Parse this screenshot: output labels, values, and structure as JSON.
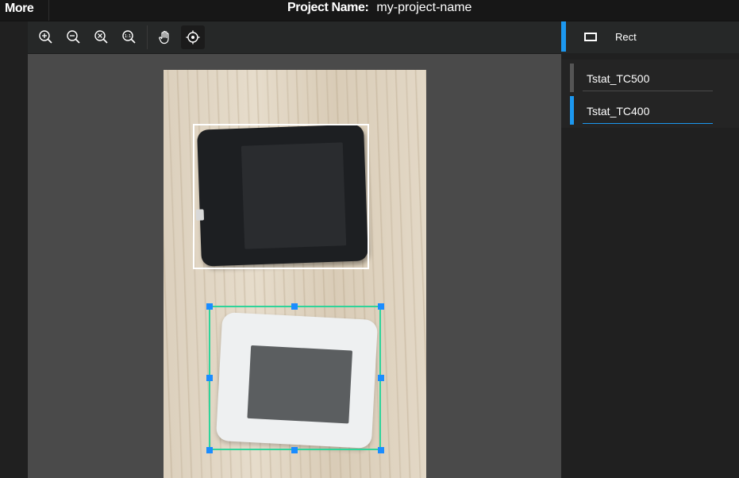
{
  "topbar": {
    "more_label": "More",
    "project_label": "Project Name:",
    "project_value": "my-project-name"
  },
  "toolbar": {
    "tools": [
      {
        "icon": "zoom-in-icon"
      },
      {
        "icon": "zoom-out-icon"
      },
      {
        "icon": "zoom-fit-icon"
      },
      {
        "icon": "zoom-actual-size-icon"
      },
      {
        "icon": "hand-pan-icon"
      },
      {
        "icon": "crosshair-icon",
        "active": true
      }
    ]
  },
  "right_panel": {
    "tool_label": "Rect",
    "labels": [
      {
        "name": "Tstat_TC500",
        "selected": false
      },
      {
        "name": "Tstat_TC400",
        "selected": true
      }
    ]
  },
  "colors": {
    "accent": "#1c98f0",
    "selection_box": "#2fd49a",
    "handle": "#1a8cff"
  }
}
